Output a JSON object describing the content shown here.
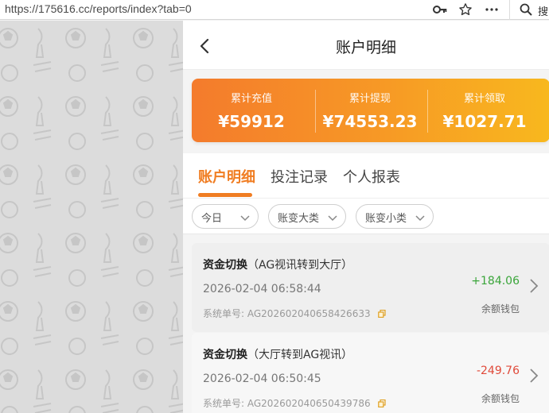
{
  "browser": {
    "url": "https://175616.cc/reports/index?tab=0",
    "search_text": "搜"
  },
  "colors": {
    "accent": "#f07d22",
    "positive": "#3aa53a",
    "negative": "#e04a3a",
    "gradient_start": "#f47b2c",
    "gradient_end": "#f8b81e"
  },
  "nav": {
    "title": "账户明细"
  },
  "summary": [
    {
      "label": "累计充值",
      "value": "¥59912"
    },
    {
      "label": "累计提现",
      "value": "¥74553.23"
    },
    {
      "label": "累计领取",
      "value": "¥1027.71"
    }
  ],
  "tabs": [
    {
      "label": "账户明细",
      "active": true
    },
    {
      "label": "投注记录",
      "active": false
    },
    {
      "label": "个人报表",
      "active": false
    }
  ],
  "filters": [
    {
      "label": "今日"
    },
    {
      "label": "账变大类"
    },
    {
      "label": "账变小类"
    }
  ],
  "records": [
    {
      "type": "资金切换",
      "detail": "（AG视讯转到大厅）",
      "time": "2026-02-04 06:58:44",
      "order_label": "系统单号:",
      "order_no": "AG202602040658426633",
      "amount": "+184.06",
      "wallet": "余额钱包"
    },
    {
      "type": "资金切换",
      "detail": "（大厅转到AG视讯）",
      "time": "2026-02-04 06:50:45",
      "order_label": "系统单号:",
      "order_no": "AG202602040650439786",
      "amount": "-249.76",
      "wallet": "余额钱包"
    }
  ]
}
